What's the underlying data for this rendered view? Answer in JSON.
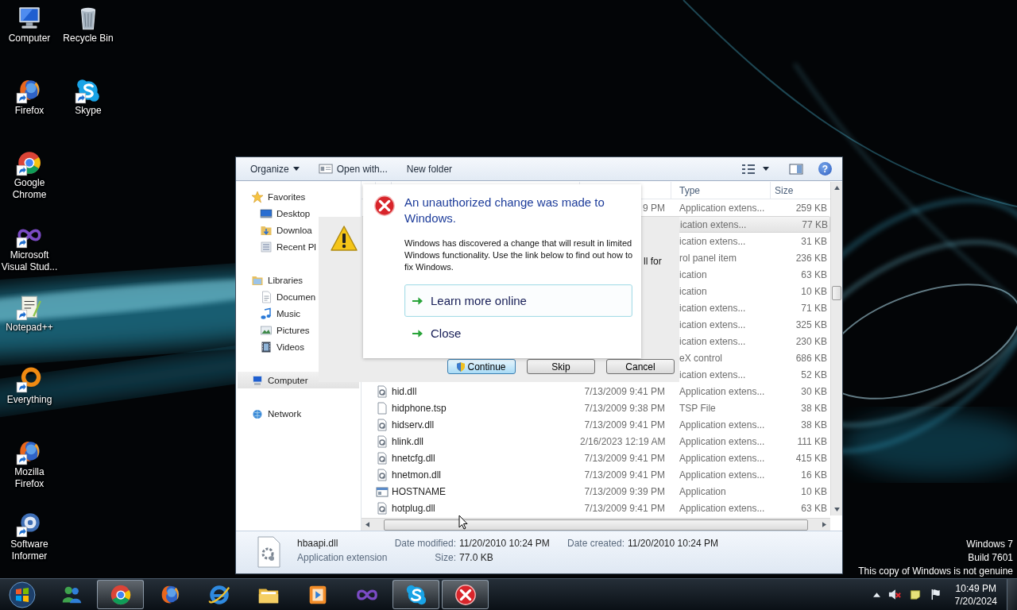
{
  "desktop": {
    "icon_rows": [
      [
        {
          "label": "Computer",
          "kind": "computer",
          "shortcut": false
        },
        {
          "label": "Recycle Bin",
          "kind": "recycle-bin",
          "shortcut": false
        }
      ],
      [
        {
          "label": "Firefox",
          "kind": "firefox",
          "shortcut": true
        },
        {
          "label": "Skype",
          "kind": "skype",
          "shortcut": true
        }
      ],
      [
        {
          "label": "Google Chrome",
          "kind": "chrome",
          "shortcut": true
        }
      ],
      [
        {
          "label": "Microsoft Visual Stud...",
          "kind": "infinity",
          "shortcut": true
        }
      ],
      [
        {
          "label": "Notepad++",
          "kind": "notepad",
          "shortcut": true
        }
      ],
      [
        {
          "label": "Everything",
          "kind": "everything",
          "shortcut": true
        }
      ],
      [
        {
          "label": "Mozilla Firefox",
          "kind": "firefox",
          "shortcut": true
        }
      ],
      [
        {
          "label": "Software Informer",
          "kind": "software-informer",
          "shortcut": true
        }
      ]
    ]
  },
  "system_notice": [
    "Windows 7",
    "Build 7601",
    "This copy of Windows is not genuine"
  ],
  "explorer": {
    "toolbar": [
      {
        "label": "Organize",
        "kind": "menu"
      },
      {
        "label": "Open with...",
        "kind": "open-with"
      },
      {
        "label": "New folder",
        "kind": "plain"
      }
    ],
    "help": "?",
    "nav": [
      {
        "label": "Favorites",
        "kind": "star",
        "selected": false,
        "children": [
          {
            "label": "Desktop",
            "kind": "desktop",
            "selected": false
          },
          {
            "label": "Downloa",
            "kind": "downloads",
            "selected": false
          },
          {
            "label": "Recent Pl",
            "kind": "recent",
            "selected": false
          }
        ]
      },
      {
        "label": "Libraries",
        "kind": "library",
        "selected": false,
        "children": [
          {
            "label": "Documen",
            "kind": "document",
            "selected": false
          },
          {
            "label": "Music",
            "kind": "music",
            "selected": false
          },
          {
            "label": "Pictures",
            "kind": "pictures",
            "selected": false
          },
          {
            "label": "Videos",
            "kind": "videos",
            "selected": false
          }
        ]
      },
      {
        "label": "Computer",
        "kind": "computer",
        "selected": true
      },
      {
        "label": "Network",
        "kind": "network",
        "selected": false
      }
    ],
    "columns": [
      "Type",
      "Size"
    ],
    "rows": [
      {
        "date": "9 PM",
        "type": "Application extens...",
        "size": "259 KB",
        "selected": false
      },
      {
        "type": "ication extens...",
        "size": "77 KB",
        "selected": true
      },
      {
        "type": "ication extens...",
        "size": "31 KB",
        "selected": false
      },
      {
        "type": "rol panel item",
        "size": "236 KB",
        "selected": false
      },
      {
        "type": "ication",
        "size": "63 KB",
        "selected": false
      },
      {
        "type": "ication",
        "size": "10 KB",
        "selected": false
      },
      {
        "type": "ication extens...",
        "size": "71 KB",
        "selected": false
      },
      {
        "type": "ication extens...",
        "size": "325 KB",
        "selected": false
      },
      {
        "type": "ication extens...",
        "size": "230 KB",
        "selected": false
      },
      {
        "type": "eX control",
        "size": "686 KB",
        "selected": false
      },
      {
        "type": "ication extens...",
        "size": "52 KB",
        "selected": false
      },
      {
        "kind": "dll",
        "name": "hid.dll",
        "date": "7/13/2009 9:41 PM",
        "type": "Application extens...",
        "size": "30 KB",
        "selected": false
      },
      {
        "kind": "file",
        "name": "hidphone.tsp",
        "date": "7/13/2009 9:38 PM",
        "type": "TSP File",
        "size": "38 KB",
        "selected": false
      },
      {
        "kind": "dll",
        "name": "hidserv.dll",
        "date": "7/13/2009 9:41 PM",
        "type": "Application extens...",
        "size": "38 KB",
        "selected": false
      },
      {
        "kind": "dll",
        "name": "hlink.dll",
        "date": "2/16/2023 12:19 AM",
        "type": "Application extens...",
        "size": "111 KB",
        "selected": false
      },
      {
        "kind": "dll",
        "name": "hnetcfg.dll",
        "date": "7/13/2009 9:41 PM",
        "type": "Application extens...",
        "size": "415 KB",
        "selected": false
      },
      {
        "kind": "dll",
        "name": "hnetmon.dll",
        "date": "7/13/2009 9:41 PM",
        "type": "Application extens...",
        "size": "16 KB",
        "selected": false
      },
      {
        "kind": "app",
        "name": "HOSTNAME",
        "date": "7/13/2009 9:39 PM",
        "type": "Application",
        "size": "10 KB",
        "selected": false
      },
      {
        "kind": "dll",
        "name": "hotplug.dll",
        "date": "7/13/2009 9:41 PM",
        "type": "Application extens...",
        "size": "63 KB",
        "selected": false
      }
    ],
    "details": {
      "name": "hbaapi.dll",
      "type": "Application extension",
      "property_columns": [
        [
          {
            "label": "Date modified:",
            "value": "11/20/2010 10:24 PM"
          },
          {
            "label": "Size:",
            "value": "77.0 KB"
          }
        ],
        [
          {
            "label": "Date created:",
            "value": "11/20/2010 10:24 PM"
          }
        ]
      ]
    }
  },
  "copy_dialog": {
    "text_fragment": "ll for",
    "buttons": [
      {
        "label": "Continue",
        "kind": "shield",
        "default": true
      },
      {
        "label": "Skip",
        "kind": "plain",
        "default": false
      },
      {
        "label": "Cancel",
        "kind": "plain",
        "default": false
      }
    ]
  },
  "error_dialog": {
    "title": "An unauthorized change was made to Windows.",
    "message": "Windows has discovered a change that will result in limited Windows functionality. Use the link below to find out how to fix Windows.",
    "links": [
      {
        "label": "Learn more online",
        "selected": true
      },
      {
        "label": "Close",
        "selected": false
      }
    ]
  },
  "taskbar": {
    "buttons": [
      {
        "kind": "messenger",
        "running": false
      },
      {
        "kind": "chrome",
        "running": true
      },
      {
        "kind": "firefox",
        "running": false
      },
      {
        "kind": "ie",
        "running": false
      },
      {
        "kind": "folder",
        "running": false
      },
      {
        "kind": "media",
        "running": false
      },
      {
        "kind": "infinity",
        "running": false
      },
      {
        "kind": "skype",
        "running": true
      },
      {
        "kind": "error",
        "running": true
      }
    ],
    "tray": {
      "volume_muted": true,
      "time": "10:49 PM",
      "date": "7/20/2024"
    }
  }
}
